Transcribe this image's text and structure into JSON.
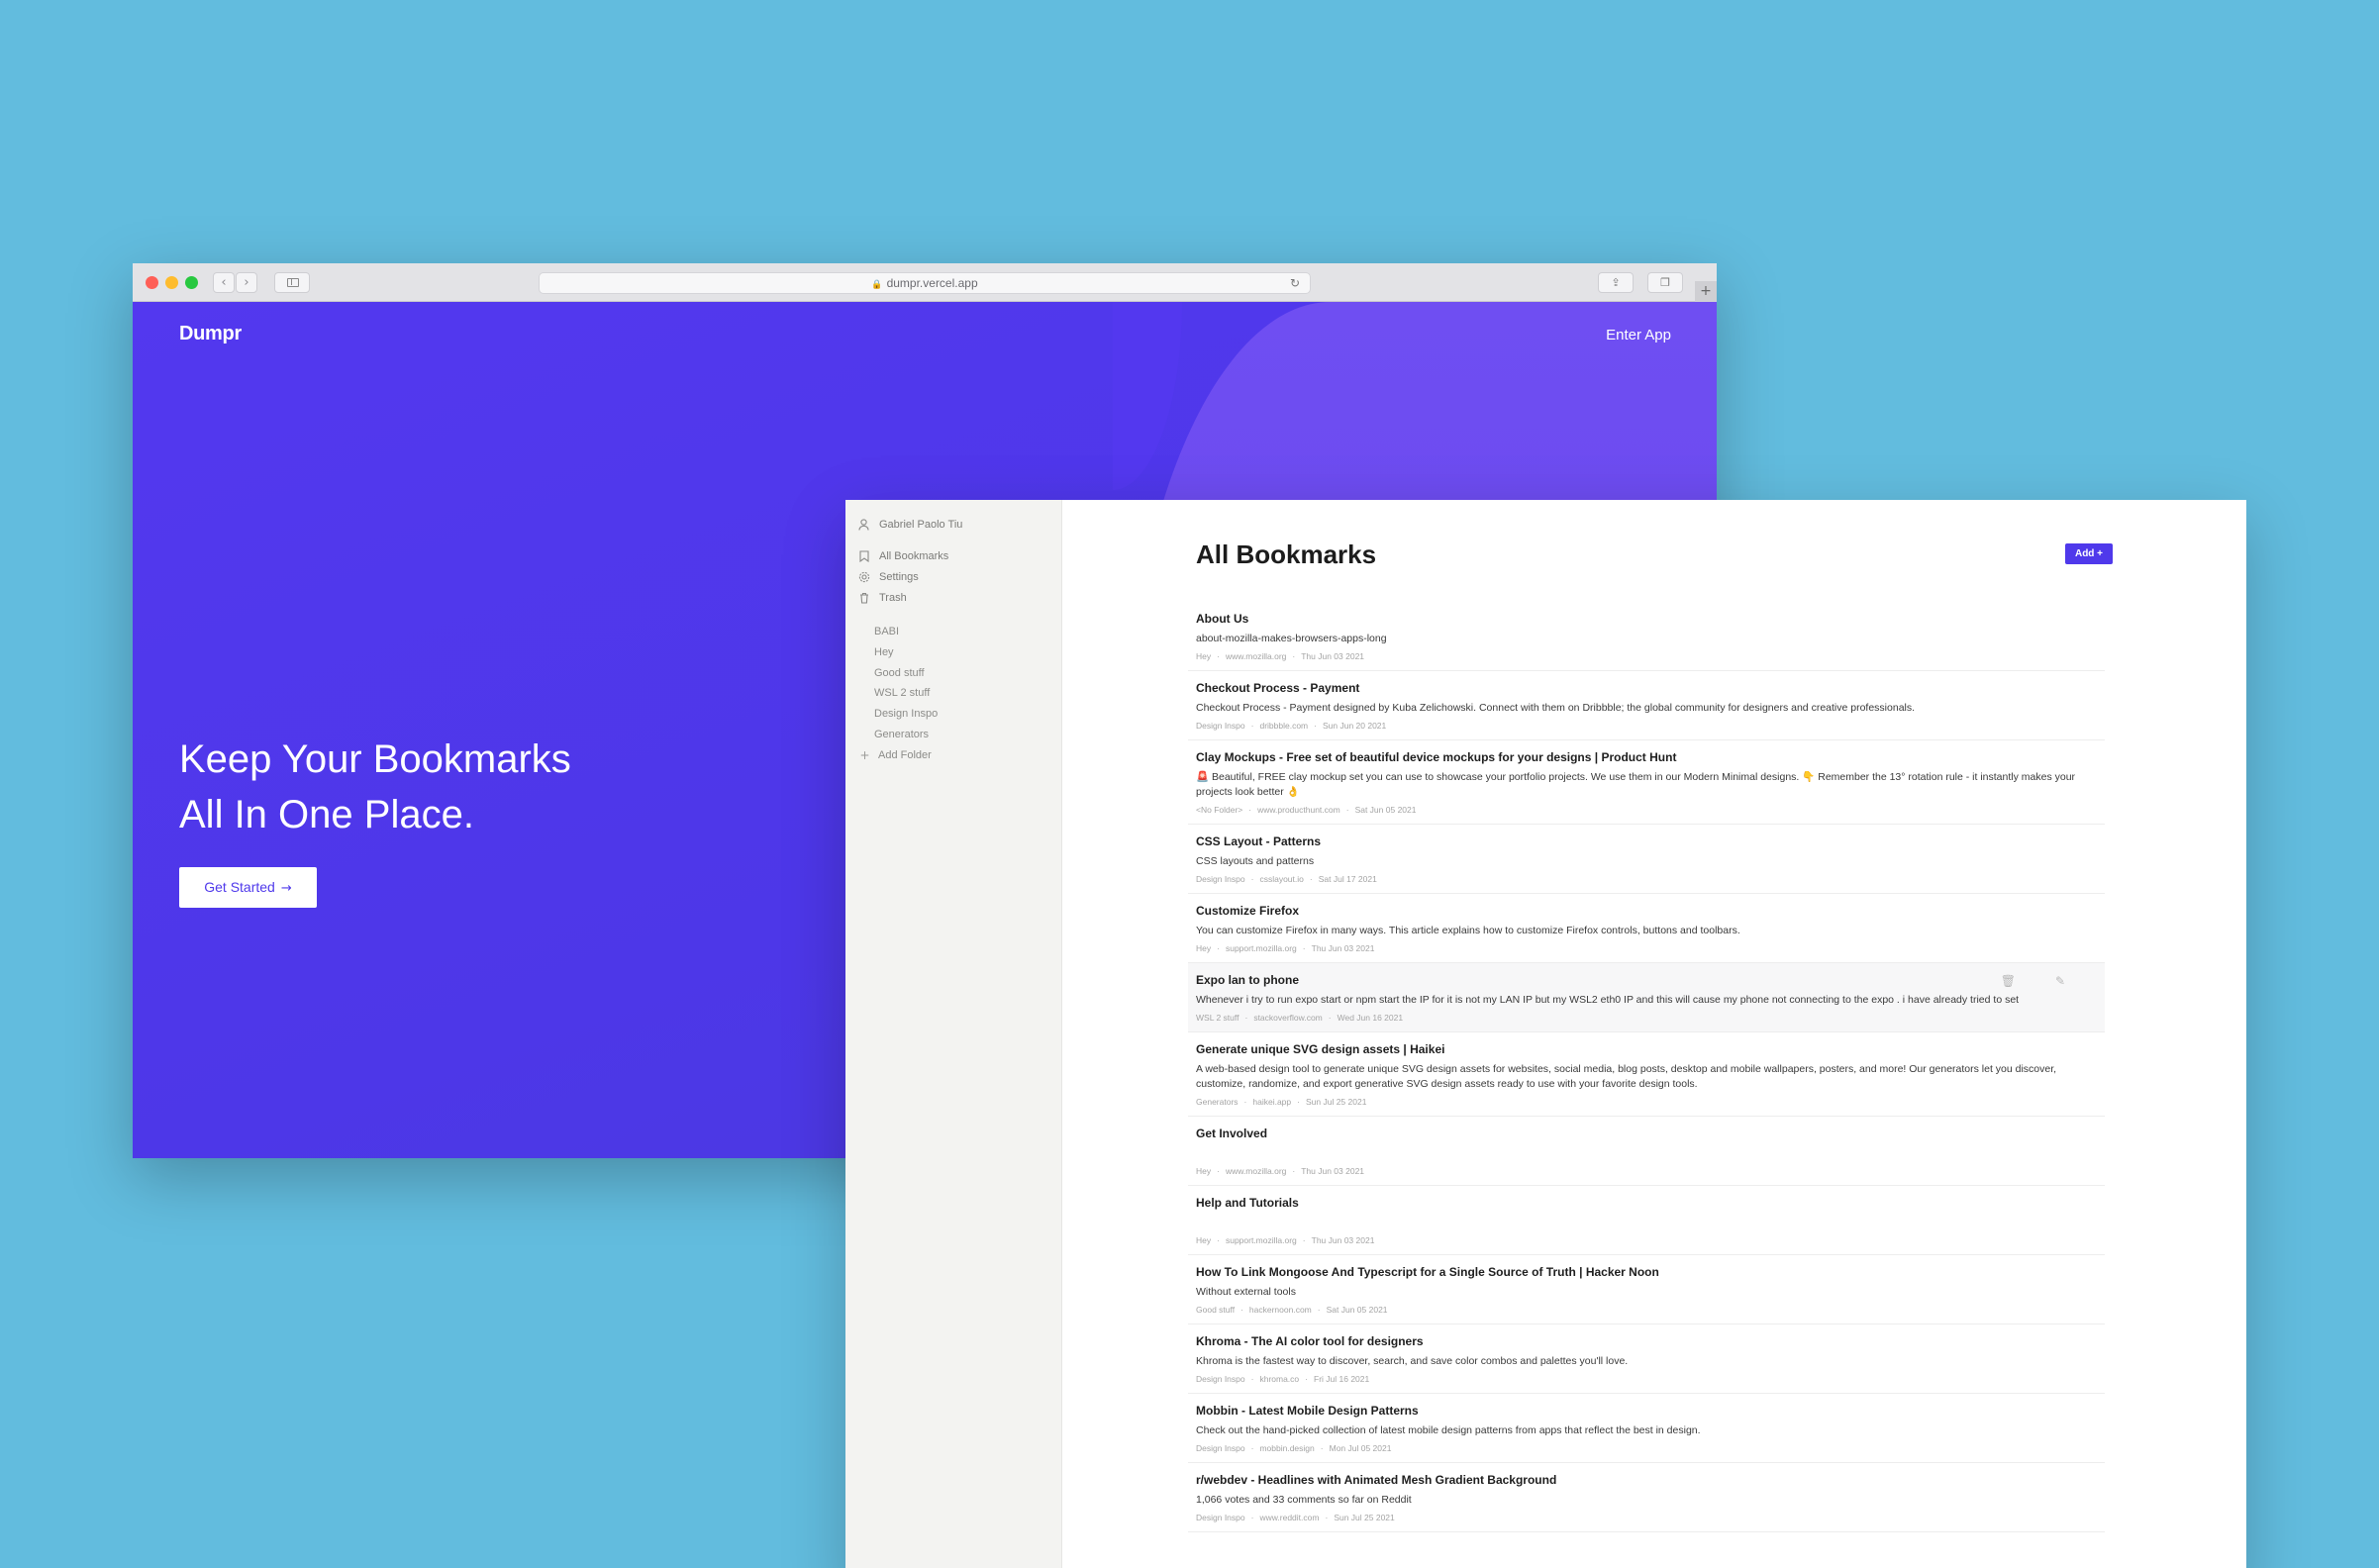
{
  "browser": {
    "url": "dumpr.vercel.app",
    "logo": "Dumpr",
    "nav_link": "Enter App",
    "hero_line1": "Keep Your Bookmarks",
    "hero_line2": "All In One Place.",
    "cta": "Get Started",
    "colors": {
      "brand": "#4f39eb",
      "wave": "#6f4ef2",
      "background": "#62bcde"
    }
  },
  "app": {
    "user": "Gabriel Paolo Tiu",
    "nav": [
      {
        "label": "All Bookmarks",
        "icon": "bookmark-icon"
      },
      {
        "label": "Settings",
        "icon": "gear-icon"
      },
      {
        "label": "Trash",
        "icon": "trash-icon"
      }
    ],
    "folders": [
      "BABI",
      "Hey",
      "Good stuff",
      "WSL 2 stuff",
      "Design Inspo",
      "Generators"
    ],
    "add_folder": "Add Folder",
    "title": "All Bookmarks",
    "add_button": "Add +",
    "bookmarks": [
      {
        "title": "About Us",
        "desc": "about-mozilla-makes-browsers-apps-long",
        "folder": "Hey",
        "domain": "www.mozilla.org",
        "date": "Thu Jun 03 2021"
      },
      {
        "title": "Checkout Process - Payment",
        "desc": "Checkout Process - Payment designed by Kuba Zelichowski. Connect with them on Dribbble; the global community for designers and creative professionals.",
        "folder": "Design Inspo",
        "domain": "dribbble.com",
        "date": "Sun Jun 20 2021"
      },
      {
        "title": "Clay Mockups - Free set of beautiful device mockups for your designs | Product Hunt",
        "desc": "🚨 Beautiful, FREE clay mockup set you can use to showcase your portfolio projects. We use them in our Modern Minimal designs. 👇 Remember the 13° rotation rule - it instantly makes your projects look better 👌",
        "folder": "<No Folder>",
        "domain": "www.producthunt.com",
        "date": "Sat Jun 05 2021"
      },
      {
        "title": "CSS Layout - Patterns",
        "desc": "CSS layouts and patterns",
        "folder": "Design Inspo",
        "domain": "csslayout.io",
        "date": "Sat Jul 17 2021"
      },
      {
        "title": "Customize Firefox",
        "desc": "You can customize Firefox in many ways. This article explains how to customize Firefox controls, buttons and toolbars.",
        "folder": "Hey",
        "domain": "support.mozilla.org",
        "date": "Thu Jun 03 2021"
      },
      {
        "title": "Expo lan to phone",
        "desc": "Whenever i try to run expo start or npm start the IP for it is not my LAN IP but my WSL2 eth0 IP and this will cause my phone not connecting to the expo . i have already tried to set",
        "folder": "WSL 2 stuff",
        "domain": "stackoverflow.com",
        "date": "Wed Jun 16 2021"
      },
      {
        "title": "Generate unique SVG design assets | Haikei",
        "desc": "A web-based design tool to generate unique SVG design assets for websites, social media, blog posts, desktop and mobile wallpapers, posters, and more! Our generators let you discover, customize, randomize, and export generative SVG design assets ready to use with your favorite design tools.",
        "folder": "Generators",
        "domain": "haikei.app",
        "date": "Sun Jul 25 2021"
      },
      {
        "title": "Get Involved",
        "desc": "",
        "folder": "Hey",
        "domain": "www.mozilla.org",
        "date": "Thu Jun 03 2021"
      },
      {
        "title": "Help and Tutorials",
        "desc": "",
        "folder": "Hey",
        "domain": "support.mozilla.org",
        "date": "Thu Jun 03 2021"
      },
      {
        "title": "How To Link Mongoose And Typescript for a Single Source of Truth | Hacker Noon",
        "desc": "Without external tools",
        "folder": "Good stuff",
        "domain": "hackernoon.com",
        "date": "Sat Jun 05 2021"
      },
      {
        "title": "Khroma - The AI color tool for designers",
        "desc": "Khroma is the fastest way to discover, search, and save color combos and palettes you'll love.",
        "folder": "Design Inspo",
        "domain": "khroma.co",
        "date": "Fri Jul 16 2021"
      },
      {
        "title": "Mobbin - Latest Mobile Design Patterns",
        "desc": "Check out the hand-picked collection of latest mobile design patterns from apps that reflect the best in design.",
        "folder": "Design Inspo",
        "domain": "mobbin.design",
        "date": "Mon Jul 05 2021"
      },
      {
        "title": "r/webdev - Headlines with Animated Mesh Gradient Background",
        "desc": "1,066 votes and 33 comments so far on Reddit",
        "folder": "Design Inspo",
        "domain": "www.reddit.com",
        "date": "Sun Jul 25 2021"
      }
    ]
  }
}
